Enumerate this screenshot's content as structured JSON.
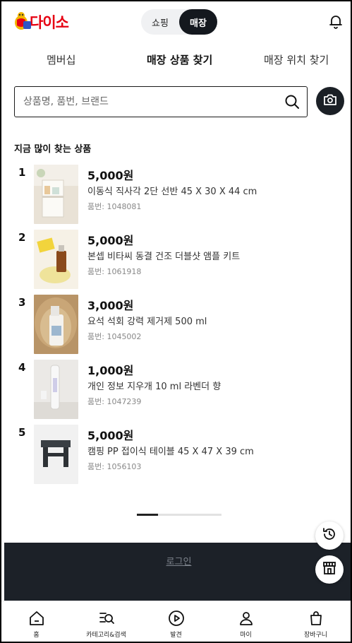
{
  "header": {
    "logo_text": "다이소",
    "toggle": {
      "shopping": "쇼핑",
      "store": "매장",
      "active": "store"
    }
  },
  "tabs": [
    {
      "label": "멤버십"
    },
    {
      "label": "매장 상품 찾기",
      "active": true
    },
    {
      "label": "매장 위치 찾기"
    }
  ],
  "search": {
    "placeholder": "상품명, 품번, 브랜드"
  },
  "popular": {
    "title": "지금 많이 찾는 상품",
    "items": [
      {
        "rank": "1",
        "price": "5,000원",
        "name": "이동식 직사각 2단 선반 45 X 30 X 44 cm",
        "code": "품번: 1048081"
      },
      {
        "rank": "2",
        "price": "5,000원",
        "name": "본셉 비타씨 동결 건조 더블샷 앰플 키트",
        "code": "품번: 1061918"
      },
      {
        "rank": "3",
        "price": "3,000원",
        "name": "요석 석회 강력 제거제 500 ml",
        "code": "품번: 1045002"
      },
      {
        "rank": "4",
        "price": "1,000원",
        "name": "개인 정보 지우개 10 ml 라벤더 향",
        "code": "품번: 1047239"
      },
      {
        "rank": "5",
        "price": "5,000원",
        "name": "캠핑 PP 접이식 테이블 45 X 47 X 39 cm",
        "code": "품번: 1056103"
      }
    ]
  },
  "pager": {
    "current_fraction": 0.25
  },
  "footer": {
    "login": "로그인"
  },
  "bottom_nav": [
    {
      "label": "홈",
      "icon": "home-icon"
    },
    {
      "label": "카테고리&검색",
      "icon": "category-search-icon"
    },
    {
      "label": "발견",
      "icon": "play-icon"
    },
    {
      "label": "마이",
      "icon": "user-icon"
    },
    {
      "label": "장바구니",
      "icon": "bag-icon"
    }
  ],
  "colors": {
    "brand_red": "#e60012",
    "dark": "#1c2128"
  }
}
